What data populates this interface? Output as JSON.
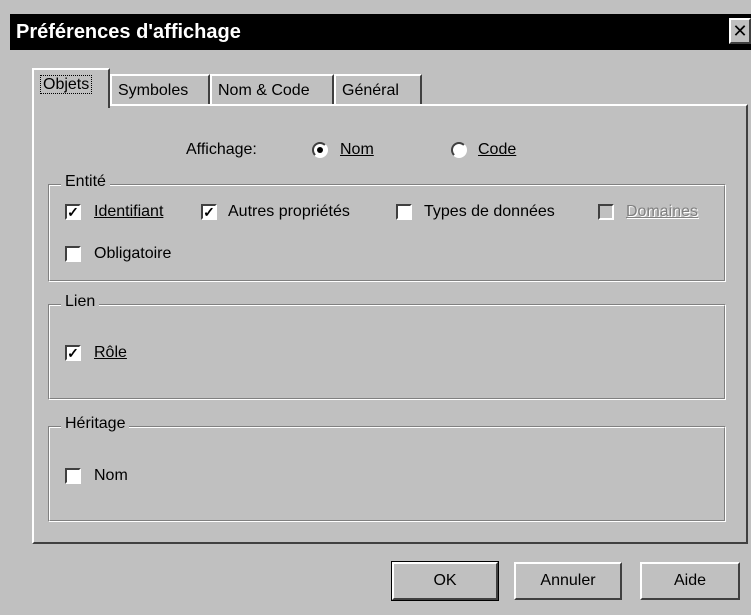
{
  "window": {
    "title": "Préférences d'affichage",
    "close_glyph": "✕"
  },
  "tabs": [
    {
      "label": "Objets",
      "active": true
    },
    {
      "label": "Symboles",
      "active": false
    },
    {
      "label": "Nom & Code",
      "active": false
    },
    {
      "label": "Général",
      "active": false
    }
  ],
  "affichage": {
    "label": "Affichage:",
    "options": [
      {
        "label": "Nom",
        "selected": true
      },
      {
        "label": "Code",
        "selected": false
      }
    ]
  },
  "groups": {
    "entite": {
      "title": "Entité",
      "options": [
        {
          "label": "Identifiant",
          "checked": true,
          "enabled": true
        },
        {
          "label": "Autres propriétés",
          "checked": true,
          "enabled": true
        },
        {
          "label": "Types de données",
          "checked": false,
          "enabled": true
        },
        {
          "label": "Domaines",
          "checked": false,
          "enabled": false
        },
        {
          "label": "Obligatoire",
          "checked": false,
          "enabled": true
        }
      ]
    },
    "lien": {
      "title": "Lien",
      "options": [
        {
          "label": "Rôle",
          "checked": true,
          "enabled": true
        }
      ]
    },
    "heritage": {
      "title": "Héritage",
      "options": [
        {
          "label": "Nom",
          "checked": false,
          "enabled": true
        }
      ]
    }
  },
  "buttons": {
    "ok": "OK",
    "cancel": "Annuler",
    "help": "Aide"
  },
  "colors": {
    "dialog_bg": "#c0c0c0",
    "titlebar_bg": "#000000",
    "disabled_text": "#808080"
  }
}
